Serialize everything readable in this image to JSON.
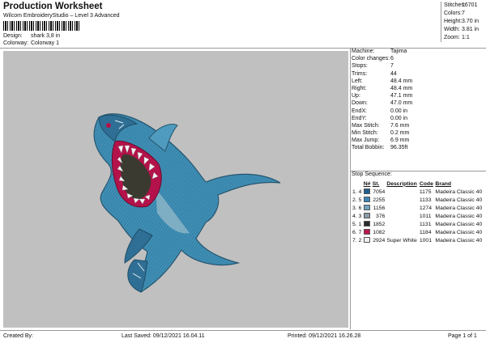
{
  "header": {
    "title": "Production Worksheet",
    "software": "Wilcom EmbroideryStudio – Level 3 Advanced",
    "design_label": "Design:",
    "design_value": "shark 3,8 in",
    "colorway_label": "Colorway:",
    "colorway_value": "Colorway 1"
  },
  "summary": [
    {
      "k": "Stitches:",
      "v": "16701"
    },
    {
      "k": "Colors:",
      "v": "7"
    },
    {
      "k": "Height:",
      "v": "3.70 in"
    },
    {
      "k": "Width:",
      "v": "3.81 in"
    },
    {
      "k": "Zoom:",
      "v": "1:1"
    }
  ],
  "info": [
    {
      "k": "Machine:",
      "v": "Tajima"
    },
    {
      "k": "Color changes:",
      "v": "6"
    },
    {
      "k": "Stops:",
      "v": "7"
    },
    {
      "k": "Trims:",
      "v": "44"
    },
    {
      "k": "Left:",
      "v": "48.4 mm"
    },
    {
      "k": "Right:",
      "v": "48.4 mm"
    },
    {
      "k": "Up:",
      "v": "47.1 mm"
    },
    {
      "k": "Down:",
      "v": "47.0 mm"
    },
    {
      "k": "EndX:",
      "v": "0.00 in"
    },
    {
      "k": "EndY:",
      "v": "0.00 in"
    },
    {
      "k": "Max Stitch:",
      "v": "7.6 mm"
    },
    {
      "k": "Min Stitch:",
      "v": "0.2 mm"
    },
    {
      "k": "Max Jump:",
      "v": "6.9 mm"
    },
    {
      "k": "Total Bobbin:",
      "v": "96.35ft"
    }
  ],
  "sequence": {
    "title": "Stop Sequence:",
    "headers": [
      "",
      "N#",
      "St.",
      "Description",
      "Code",
      "Brand"
    ],
    "rows": [
      {
        "idx": "1.",
        "n": "4",
        "color": "#1f5f8f",
        "st": "7054",
        "desc": "",
        "code": "1175",
        "brand": "Madeira Classic 40"
      },
      {
        "idx": "2.",
        "n": "5",
        "color": "#3b86b6",
        "st": "2255",
        "desc": "",
        "code": "1133",
        "brand": "Madeira Classic 40"
      },
      {
        "idx": "3.",
        "n": "6",
        "color": "#6ea3be",
        "st": "1156",
        "desc": "",
        "code": "1274",
        "brand": "Madeira Classic 40"
      },
      {
        "idx": "4.",
        "n": "3",
        "color": "#8a9aa6",
        "st": "376",
        "desc": "",
        "code": "1011",
        "brand": "Madeira Classic 40"
      },
      {
        "idx": "5.",
        "n": "1",
        "color": "#2a2a2a",
        "st": "1852",
        "desc": "",
        "code": "1131",
        "brand": "Madeira Classic 40"
      },
      {
        "idx": "6.",
        "n": "7",
        "color": "#c0154a",
        "st": "1082",
        "desc": "",
        "code": "1184",
        "brand": "Madeira Classic 40"
      },
      {
        "idx": "7.",
        "n": "2",
        "color": "#f2f2f2",
        "st": "2924",
        "desc": "Super White",
        "code": "1001",
        "brand": "Madeira Classic 40"
      }
    ]
  },
  "footer": {
    "created": "Created By:",
    "saved": "Last Saved: 09/12/2021 16.04.11",
    "printed": "Printed: 09/12/2021 16.26.28",
    "page": "Page 1 of 1"
  }
}
